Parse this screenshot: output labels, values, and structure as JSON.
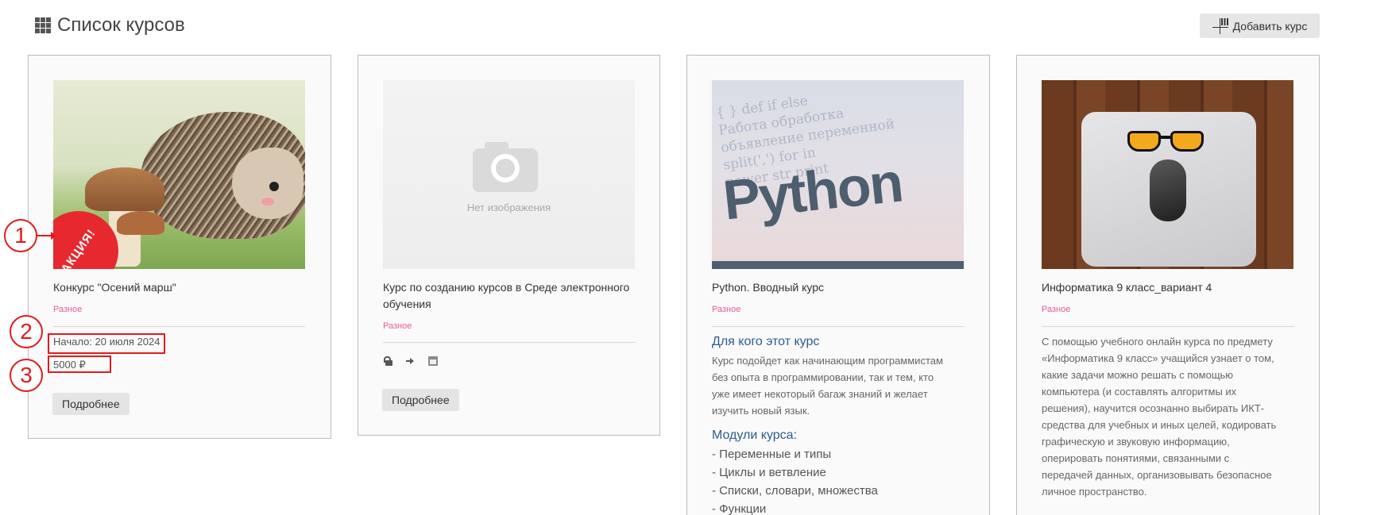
{
  "header": {
    "title": "Список курсов",
    "add_button": "Добавить курс"
  },
  "courses": [
    {
      "title": "Конкурс \"Осений марш\"",
      "category": "Разное",
      "badge": "АКЦИЯ!",
      "start": "Начало: 20 июля 2024",
      "price": "5000 ₽",
      "button": "Подробнее"
    },
    {
      "title_line1": "Курс по созданию курсов в Среде электронного",
      "title_line2": "обучения",
      "category": "Разное",
      "image_placeholder": "Нет изображения",
      "icons": [
        "unlock-icon",
        "enter-icon",
        "calendar-icon"
      ],
      "button": "Подробнее"
    },
    {
      "title": "Python. Вводный курс",
      "category": "Разное",
      "image_word": "Python",
      "image_code": [
        "{ }  def  if  else",
        "Работа обработка",
        "объявление переменной",
        "split(',')  for  in",
        "power  str  print"
      ],
      "who_heading": "Для кого этот курс",
      "who_text": [
        "Курс подойдет как начинающим программистам",
        "без опыта в программировании, так и тем, кто",
        "уже имеет некоторый багаж знаний и желает",
        "изучить новый язык."
      ],
      "modules_heading": "Модули курса:",
      "modules": [
        "- Переменные и типы",
        "- Циклы и ветвление",
        "- Списки, словари, множества",
        "- Функции"
      ]
    },
    {
      "title": "Информатика 9 класс_вариант 4",
      "category": "Разное",
      "description": [
        "С помощью учебного онлайн курса по предмету",
        "«Информатика 9 класс» учащийся узнает о том,",
        "какие задачи можно решать с помощью",
        "компьютера (и составлять алгоритмы их",
        "решения), научится осознанно выбирать ИКТ-",
        "средства для учебных и иных целей, кодировать",
        "графическую и звуковую информацию,",
        "оперировать понятиями, связанными с",
        "передачей данных, организовывать безопасное",
        "личное пространство."
      ]
    }
  ],
  "annotations": [
    "1",
    "2",
    "3"
  ],
  "colors": {
    "category": "#e85a9a",
    "annotation": "#e31b1b",
    "heading_blue": "#2c5d8f",
    "sale_badge": "#e8282f"
  }
}
